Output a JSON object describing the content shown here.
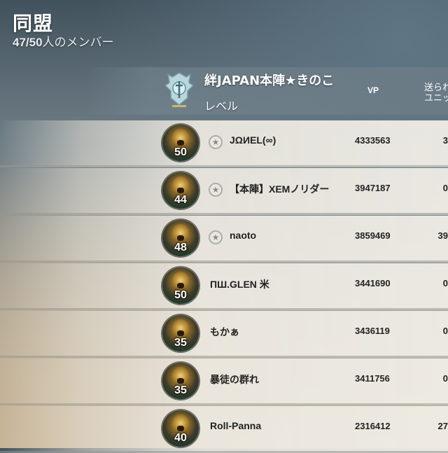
{
  "header": {
    "title": "同盟",
    "member_count": "47/50",
    "member_suffix": "人のメンバー",
    "alliance_name": "絆JAPAN本陣★きのこ",
    "level_label": "レベル",
    "vp_label": "VP",
    "sent_label_line1": "送られ",
    "sent_label_line2": "ユニッ",
    "emblem_icon": "alliance-emblem-icon"
  },
  "members": [
    {
      "level": "50",
      "name": "JΩИEL(∞)",
      "vp": "4333563",
      "sent": "3",
      "badge": true
    },
    {
      "level": "44",
      "name": "【本陣】XEMノリダー",
      "vp": "3947187",
      "sent": "0",
      "badge": true
    },
    {
      "level": "48",
      "name": "naoto",
      "vp": "3859469",
      "sent": "39",
      "badge": true
    },
    {
      "level": "50",
      "name": "ПШ.GLEN 米",
      "vp": "3441690",
      "sent": "0",
      "badge": false
    },
    {
      "level": "35",
      "name": "もかぁ",
      "vp": "3436119",
      "sent": "0",
      "badge": false
    },
    {
      "level": "35",
      "name": "暴徒の群れ",
      "vp": "3411756",
      "sent": "0",
      "badge": false
    },
    {
      "level": "40",
      "name": "Roll-Panna",
      "vp": "2316412",
      "sent": "27",
      "badge": false
    }
  ],
  "colors": {
    "row_text": "#222222",
    "header_text": "#ffffff"
  }
}
